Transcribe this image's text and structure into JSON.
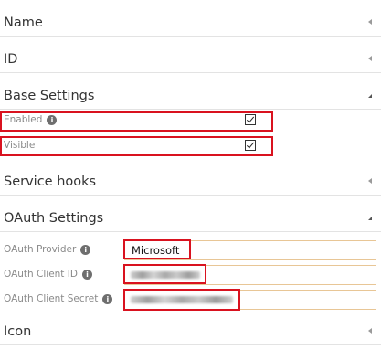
{
  "sections": {
    "name": "Name",
    "id": "ID",
    "base_settings": "Base Settings",
    "service_hooks": "Service hooks",
    "oauth_settings": "OAuth Settings",
    "icon": "Icon"
  },
  "base_settings": {
    "enabled_label": "Enabled",
    "enabled_checked": true,
    "visible_label": "Visible",
    "visible_checked": true
  },
  "oauth": {
    "provider_label": "OAuth Provider",
    "provider_value": "Microsoft",
    "client_id_label": "OAuth Client ID",
    "client_id_value": "",
    "client_secret_label": "OAuth Client Secret",
    "client_secret_value": ""
  },
  "icons": {
    "info": "info-icon",
    "collapsed": "chevron-left-icon",
    "expanded": "chevron-down-icon"
  },
  "colors": {
    "highlight": "#d9121f",
    "input_border": "#e8c696",
    "divider": "#e3e3e3"
  }
}
